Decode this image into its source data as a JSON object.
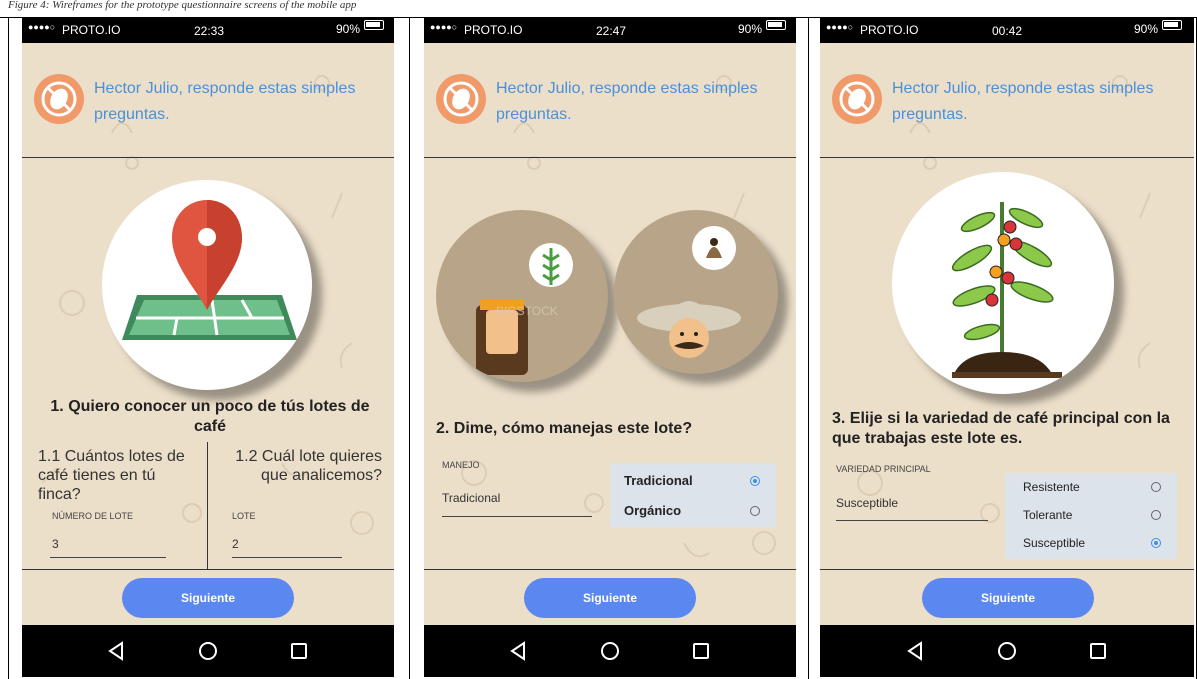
{
  "caption": "Figure 4: Wireframes for the prototype questionnaire screens of the mobile app",
  "statusbar": {
    "signal": "●●●●○",
    "carrier": "PROTO.IO",
    "battery": "90%"
  },
  "screens": [
    {
      "time": "22:33",
      "header": "Hector Julio, responde estas simples preguntas.",
      "question": "1. Quiero conocer un poco de tús lotes de café",
      "left": {
        "question": "1.1 Cuántos lotes de café tienes en tú finca?",
        "label": "NÚMERO DE LOTE",
        "value": "3"
      },
      "right": {
        "question": "1.2 Cuál lote quieres que analicemos?",
        "label": "LOTE",
        "value": "2"
      },
      "button": "Siguiente"
    },
    {
      "time": "22:47",
      "header": "Hector Julio, responde estas simples preguntas.",
      "question": "2. Dime, cómo manejas este lote?",
      "field": {
        "label": "MANEJO",
        "value": "Tradicional"
      },
      "options": [
        {
          "label": "Tradicional",
          "selected": true
        },
        {
          "label": "Orgánico",
          "selected": false
        }
      ],
      "watermark": "BIGSTOCK",
      "button": "Siguiente"
    },
    {
      "time": "00:42",
      "header": "Hector Julio, responde estas simples preguntas.",
      "question": "3. Elije si la variedad de café principal con la que trabajas este lote es.",
      "field": {
        "label": "VARIEDAD PRINCIPAL",
        "value": "Susceptible"
      },
      "options": [
        {
          "label": "Resistente",
          "selected": false
        },
        {
          "label": "Tolerante",
          "selected": false
        },
        {
          "label": "Susceptible",
          "selected": true
        }
      ],
      "button": "Siguiente"
    }
  ],
  "navbar": {
    "back": "back-icon",
    "home": "home-icon",
    "recent": "recent-apps-icon"
  },
  "colors": {
    "accent": "#5b88f0",
    "header_text": "#4a90d9",
    "background": "#ecdfca",
    "logo": "#f09a6a",
    "radio": "#3d8fe8"
  }
}
